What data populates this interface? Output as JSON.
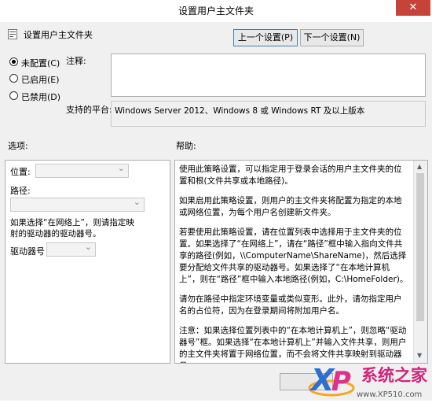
{
  "window": {
    "title": "设置用户主文件夹",
    "close_glyph": "✕"
  },
  "header": {
    "setting_name": "设置用户主文件夹",
    "prev_button": "上一个设置(P)",
    "next_button": "下一个设置(N)"
  },
  "state": {
    "options": [
      {
        "label": "未配置(C)",
        "selected": true
      },
      {
        "label": "已启用(E)",
        "selected": false
      },
      {
        "label": "已禁用(D)",
        "selected": false
      }
    ]
  },
  "comment": {
    "label": "注释:",
    "value": ""
  },
  "platform": {
    "label": "支持的平台:",
    "value": "Windows Server 2012、Windows 8 或 Windows RT 及以上版本"
  },
  "options_section": {
    "label": "选项:",
    "location_label": "位置:",
    "path_label": "路径:",
    "note": "如果选择“在网络上”，则请指定映射的驱动器的驱动器号。",
    "drive_label": "驱动器号"
  },
  "help_section": {
    "label": "帮助:",
    "paragraphs": [
      "使用此策略设置，可以指定用于登录会话的用户主文件夹的位置和根(文件共享或本地路径)。",
      "如果启用此策略设置，则用户的主文件夹将配置为指定的本地或网络位置，为每个用户名创建新文件夹。",
      "若要使用此策略设置，请在位置列表中选择用于主文件夹的位置。如果选择了“在网络上”，请在“路径”框中输入指向文件共享的路径(例如，\\\\ComputerName\\ShareName)，然后选择要分配给文件共享的驱动器号。如果选择了“在本地计算机上”，则在“路径”框中输入本地路径(例如，C:\\HomeFolder)。",
      "请勿在路径中指定环境变量或类似变形。此外，请勿指定用户名的占位符，因为在登录期间将附加用户名。",
      "注意：如果选择位置列表中的“在本地计算机上”，则忽略“驱动器号”框。如果选择“在本地计算机上”并输入文件共享，则用户的主文件夹将置于网络位置，而不会将文件共享映射到驱动器号。"
    ]
  },
  "watermark": {
    "brand": "系统之家",
    "logo_letters": "XP",
    "url": "www.XP510.com"
  },
  "colors": {
    "close_red": "#c7433a",
    "focus_blue": "#3c7fb1",
    "dialog_bg": "#f0f0f0"
  }
}
